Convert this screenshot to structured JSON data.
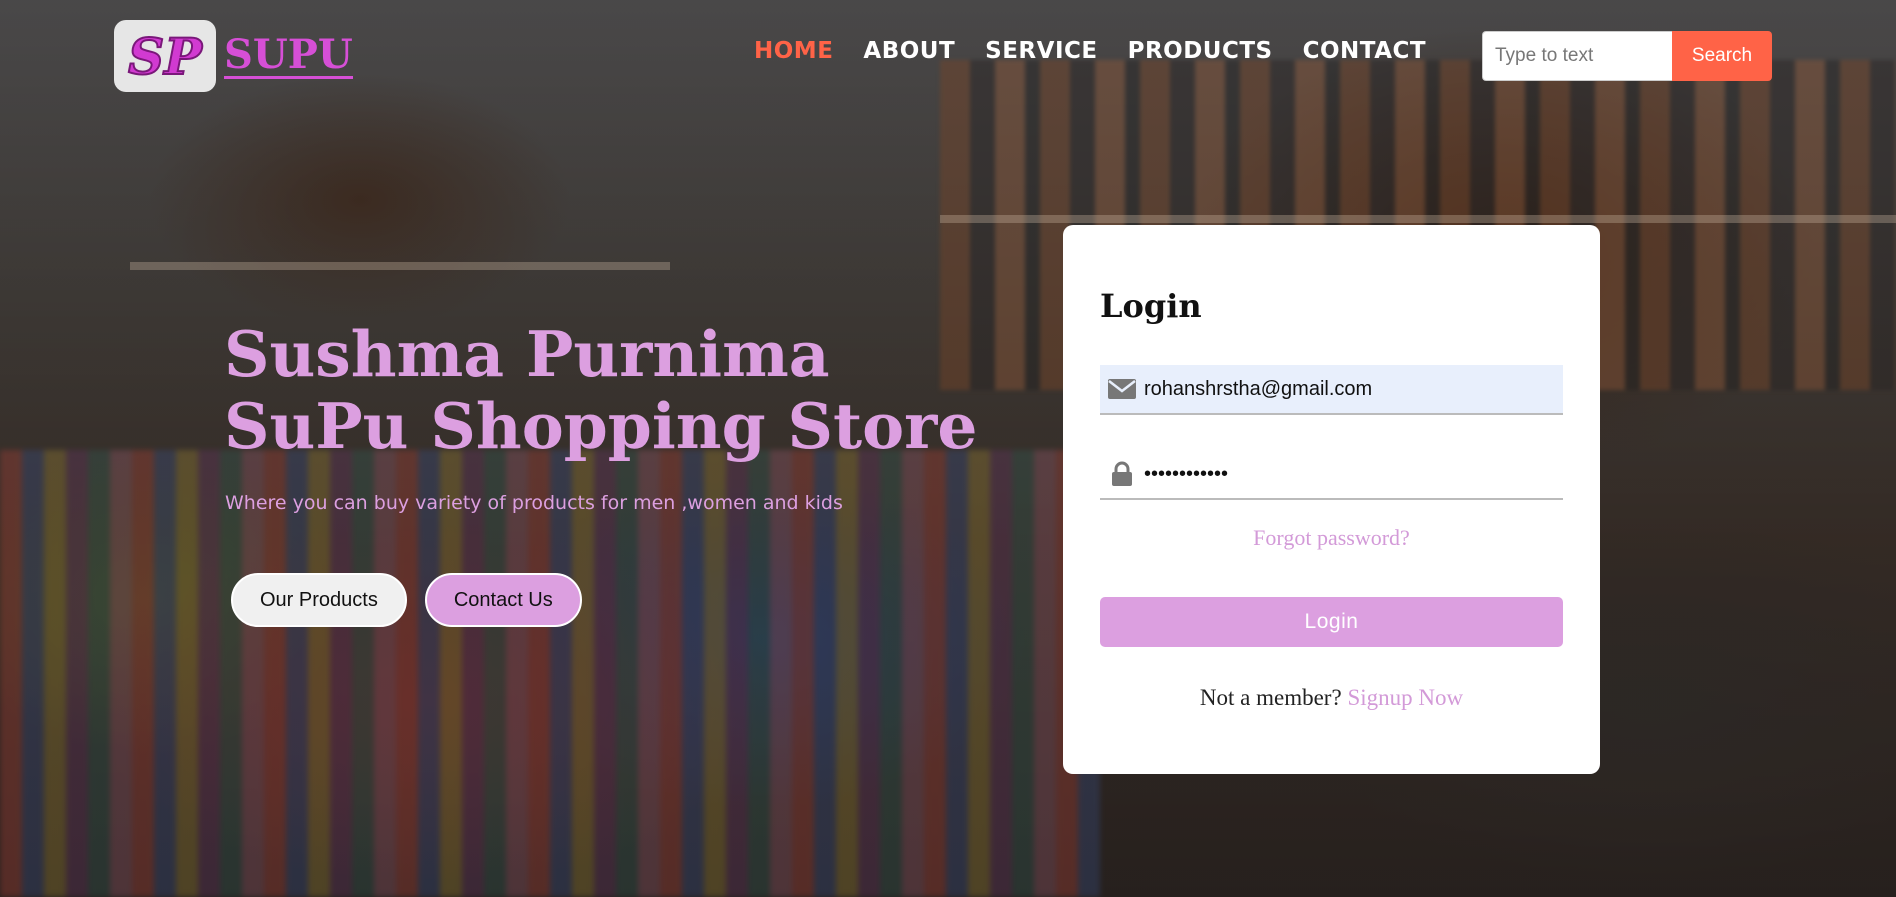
{
  "brand": {
    "logo_initials": "SP",
    "logo_name": "SUPU"
  },
  "nav": {
    "items": [
      {
        "label": "HOME",
        "active": true
      },
      {
        "label": "ABOUT",
        "active": false
      },
      {
        "label": "SERVICE",
        "active": false
      },
      {
        "label": "PRODUCTS",
        "active": false
      },
      {
        "label": "CONTACT",
        "active": false
      }
    ]
  },
  "search": {
    "placeholder": "Type to text",
    "button_label": "Search"
  },
  "hero": {
    "title_line1": "Sushma Purnima",
    "title_line2": "SuPu Shopping Store",
    "subtitle": "Where you can buy variety of products for men ,women and kids",
    "btn_products": "Our Products",
    "btn_contact": "Contact Us"
  },
  "login": {
    "title": "Login",
    "email_value": "rohanshrstha@gmail.com",
    "password_mask": "••••••••••••",
    "forgot_label": "Forgot password?",
    "login_button": "Login",
    "not_member": "Not a member?",
    "signup_label": "Signup Now"
  },
  "colors": {
    "accent": "#ff6347",
    "pink": "#dc9fe0",
    "logo_magenta": "#d13ad1"
  },
  "icons": {
    "email": "envelope-icon",
    "password": "lock-icon"
  }
}
